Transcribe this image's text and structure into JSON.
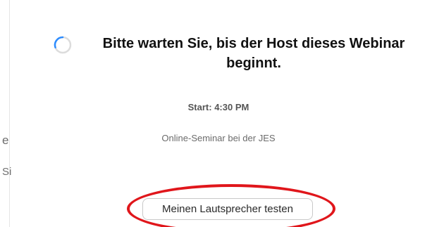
{
  "side_fragments": [
    "e",
    "Si"
  ],
  "waiting_message": "Bitte warten Sie, bis der Host dieses Webinar beginnt.",
  "start_time": "Start: 4:30 PM",
  "seminar_name": "Online-Seminar bei der JES",
  "test_speaker_button": "Meinen Lautsprecher testen",
  "colors": {
    "highlight": "#e0161b",
    "spinner_arc": "#2d8cff",
    "spinner_track": "#dcdcdc"
  }
}
